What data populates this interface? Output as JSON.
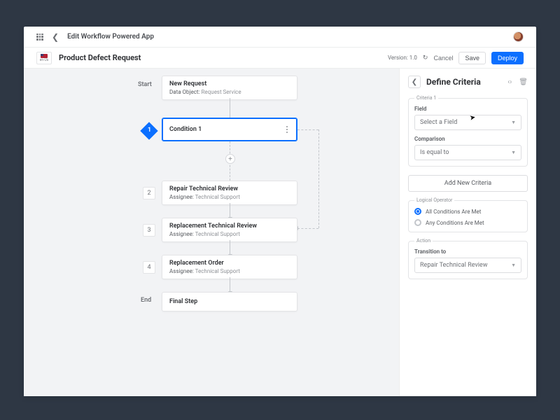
{
  "header": {
    "title": "Edit Workflow Powered App",
    "locale": "en-Us"
  },
  "page": {
    "title": "Product Defect Request",
    "version_label": "Version:",
    "version": "1.0",
    "cancel": "Cancel",
    "save": "Save",
    "deploy": "Deploy"
  },
  "workflow": {
    "start_label": "Start",
    "end_label": "End",
    "start_node": {
      "title": "New Request",
      "meta_label": "Data Object:",
      "meta_value": "Request Service"
    },
    "condition": {
      "title": "Condition 1",
      "badge": "1"
    },
    "steps": [
      {
        "num": "2",
        "title": "Repair Technical Review",
        "meta_label": "Assignee:",
        "meta_value": "Technical Support"
      },
      {
        "num": "3",
        "title": "Replacement Technical Review",
        "meta_label": "Assignee:",
        "meta_value": "Technical Support"
      },
      {
        "num": "4",
        "title": "Replacement Order",
        "meta_label": "Assignee:",
        "meta_value": "Technical Support"
      }
    ],
    "final": {
      "title": "Final Step"
    }
  },
  "panel": {
    "title": "Define Criteria",
    "criteria_legend": "Criteria 1",
    "field_label": "Field",
    "field_value": "Select a Field",
    "comparison_label": "Comparison",
    "comparison_value": "Is equal to",
    "add_criteria": "Add New Criteria",
    "logical_legend": "Logical Operator",
    "logical_all": "All Conditions Are Met",
    "logical_any": "Any Conditions Are Met",
    "action_legend": "Action",
    "transition_label": "Transition to",
    "transition_value": "Repair Technical Review"
  }
}
